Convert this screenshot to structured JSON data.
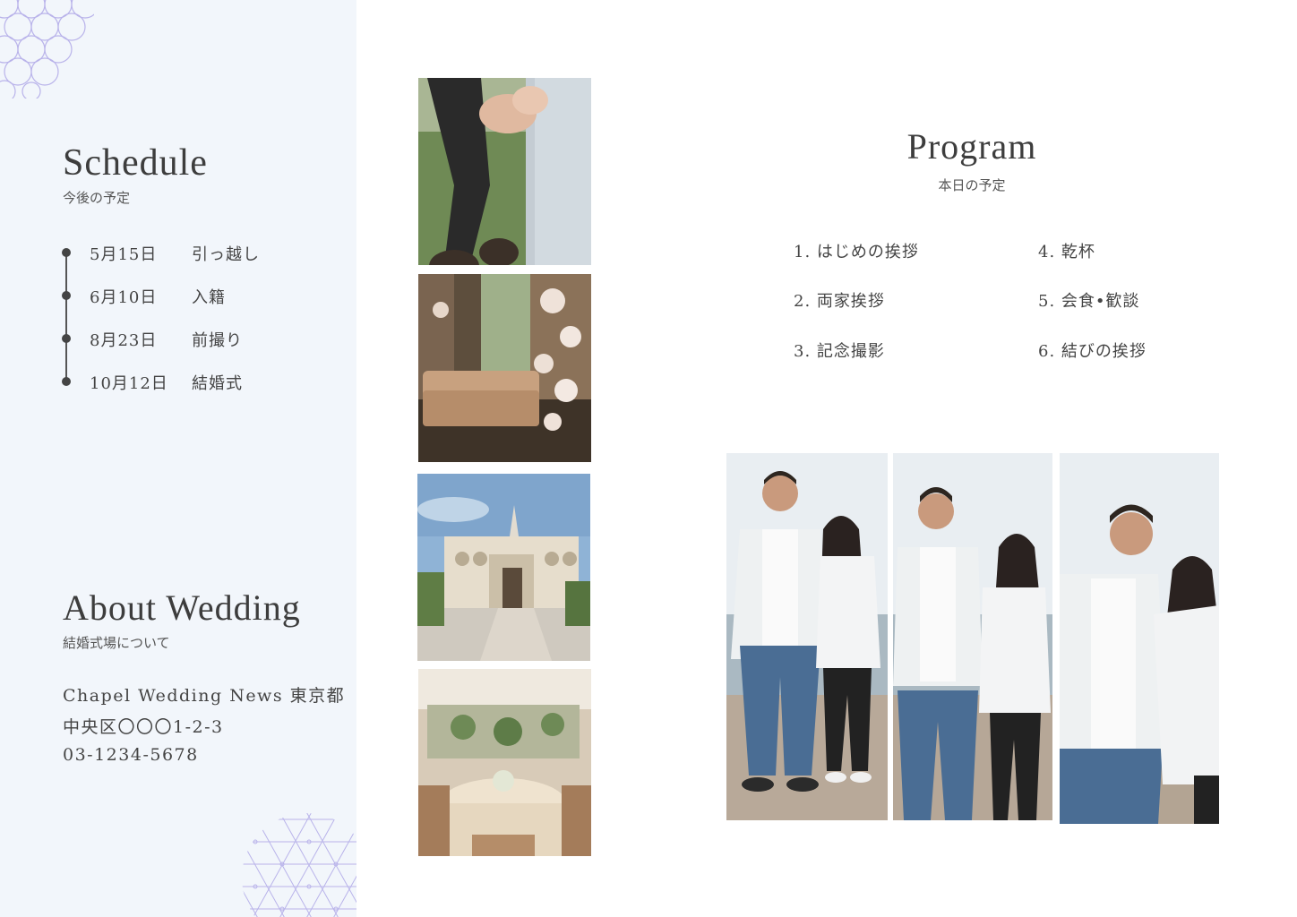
{
  "schedule": {
    "title": "Schedule",
    "subtitle": "今後の予定",
    "items": [
      {
        "date": "5月15日",
        "event": "引っ越し"
      },
      {
        "date": "6月10日",
        "event": "入籍"
      },
      {
        "date": "8月23日",
        "event": "前撮り"
      },
      {
        "date": "10月12日",
        "event": "結婚式"
      }
    ]
  },
  "about": {
    "title": "About Wedding",
    "subtitle": "結婚式場について",
    "lines": [
      "Chapel Wedding News 東京都",
      "中央区〇〇〇1-2-3",
      "03-1234-5678"
    ]
  },
  "program": {
    "title": "Program",
    "subtitle": "本日の予定",
    "items": [
      "1.  はじめの挨拶",
      "2. 両家挨拶",
      "3. 記念撮影",
      "4. 乾杯",
      "5. 会食•歓談",
      "6. 結びの挨拶"
    ]
  },
  "colors": {
    "panel": "#f2f6fb",
    "pattern": "#b9b3ea",
    "text": "#444444"
  }
}
